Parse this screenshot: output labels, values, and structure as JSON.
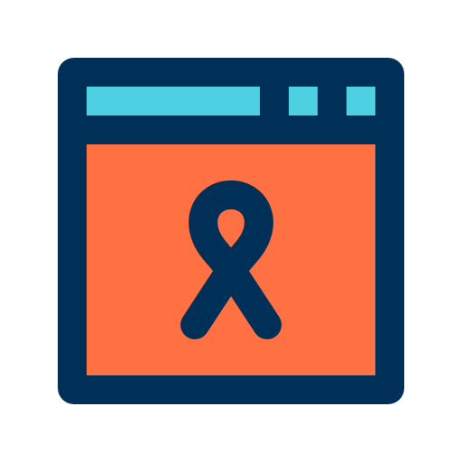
{
  "icon": {
    "name": "awareness-ribbon-browser-window-icon",
    "colors": {
      "outline": "#003057",
      "titlebar": "#4dd0e1",
      "content": "#ff7043",
      "background": "#ffffff"
    }
  }
}
